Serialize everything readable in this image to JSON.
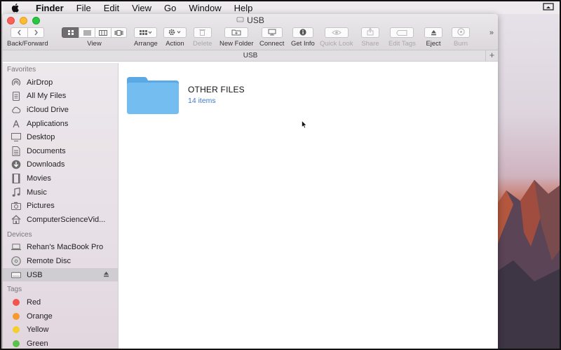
{
  "menubar": {
    "app_name": "Finder",
    "items": [
      "File",
      "Edit",
      "View",
      "Go",
      "Window",
      "Help"
    ]
  },
  "window": {
    "title": "USB",
    "path_title": "USB"
  },
  "toolbar": {
    "back_forward_label": "Back/Forward",
    "view_label": "View",
    "arrange_label": "Arrange",
    "action_label": "Action",
    "delete_label": "Delete",
    "new_folder_label": "New Folder",
    "connect_label": "Connect",
    "get_info_label": "Get Info",
    "quick_look_label": "Quick Look",
    "share_label": "Share",
    "edit_tags_label": "Edit Tags",
    "eject_label": "Eject",
    "burn_label": "Burn",
    "overflow": "»"
  },
  "sidebar": {
    "favorites_heading": "Favorites",
    "favorites": [
      {
        "label": "AirDrop",
        "icon": "airdrop-icon"
      },
      {
        "label": "All My Files",
        "icon": "all-files-icon"
      },
      {
        "label": "iCloud Drive",
        "icon": "cloud-icon"
      },
      {
        "label": "Applications",
        "icon": "applications-icon"
      },
      {
        "label": "Desktop",
        "icon": "desktop-icon"
      },
      {
        "label": "Documents",
        "icon": "documents-icon"
      },
      {
        "label": "Downloads",
        "icon": "downloads-icon"
      },
      {
        "label": "Movies",
        "icon": "movies-icon"
      },
      {
        "label": "Music",
        "icon": "music-icon"
      },
      {
        "label": "Pictures",
        "icon": "pictures-icon"
      },
      {
        "label": "ComputerScienceVid...",
        "icon": "home-icon"
      }
    ],
    "devices_heading": "Devices",
    "devices": [
      {
        "label": "Rehan's MacBook Pro",
        "icon": "laptop-icon"
      },
      {
        "label": "Remote Disc",
        "icon": "disc-icon"
      },
      {
        "label": "USB",
        "icon": "drive-icon",
        "selected": true
      }
    ],
    "tags_heading": "Tags",
    "tags": [
      {
        "label": "Red",
        "color": "#f4544e"
      },
      {
        "label": "Orange",
        "color": "#f79a2e"
      },
      {
        "label": "Yellow",
        "color": "#f6cd2f"
      },
      {
        "label": "Green",
        "color": "#5ac14a"
      }
    ]
  },
  "content": {
    "items": [
      {
        "name": "OTHER FILES",
        "subtitle": "14 items",
        "icon": "folder-icon"
      }
    ]
  },
  "colors": {
    "folder_blue": "#6fb7ec",
    "link_blue": "#3d7ac7",
    "selection_gray": "#cfcdd1"
  }
}
